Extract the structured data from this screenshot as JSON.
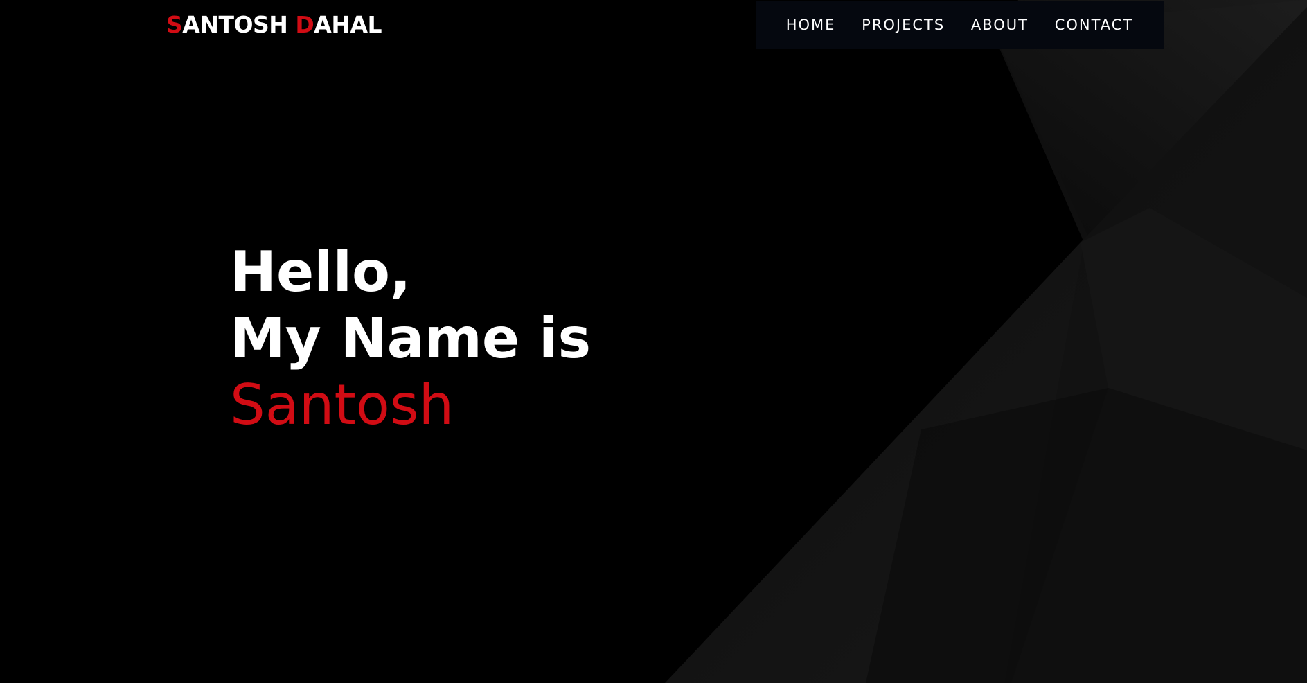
{
  "brand": {
    "first_initial": "S",
    "first_rest": "ANTOSH",
    "last_initial": "D",
    "last_rest": "AHAL"
  },
  "nav": {
    "items": [
      {
        "label": "HOME"
      },
      {
        "label": "PROJECTS"
      },
      {
        "label": "ABOUT"
      },
      {
        "label": "CONTACT"
      }
    ]
  },
  "hero": {
    "line1": "Hello,",
    "line2": "My Name is",
    "name": "Santosh"
  },
  "colors": {
    "accent": "#d10c14",
    "background": "#000000",
    "nav_background": "#05080f",
    "text": "#ffffff"
  }
}
